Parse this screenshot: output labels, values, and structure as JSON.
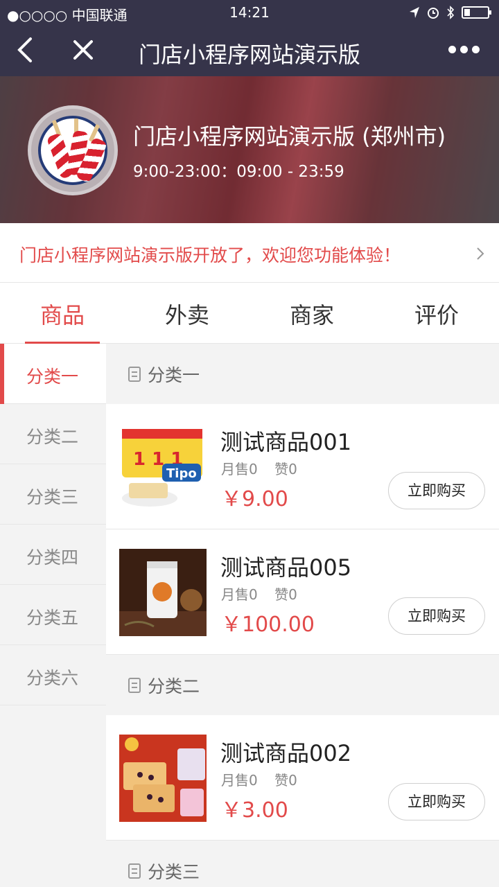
{
  "status": {
    "carrier": "●○○○○ 中国联通",
    "time": "14:21"
  },
  "nav": {
    "title": "门店小程序网站演示版"
  },
  "store": {
    "name": "门店小程序网站演示版 (郑州市)",
    "hours": "9:00-23:00：09:00 - 23:59"
  },
  "notice": {
    "text": "门店小程序网站演示版开放了，欢迎您功能体验！"
  },
  "tabs": [
    {
      "label": "商品"
    },
    {
      "label": "外卖"
    },
    {
      "label": "商家"
    },
    {
      "label": "评价"
    }
  ],
  "categories": [
    {
      "label": "分类一"
    },
    {
      "label": "分类二"
    },
    {
      "label": "分类三"
    },
    {
      "label": "分类四"
    },
    {
      "label": "分类五"
    },
    {
      "label": "分类六"
    }
  ],
  "sections": [
    {
      "title": "分类一",
      "products": [
        {
          "name": "测试商品001",
          "sales": "月售0",
          "likes": "赞0",
          "price": "￥9.00",
          "button": "立即购买"
        },
        {
          "name": "测试商品005",
          "sales": "月售0",
          "likes": "赞0",
          "price": "￥100.00",
          "button": "立即购买"
        }
      ]
    },
    {
      "title": "分类二",
      "products": [
        {
          "name": "测试商品002",
          "sales": "月售0",
          "likes": "赞0",
          "price": "￥3.00",
          "button": "立即购买"
        }
      ]
    },
    {
      "title": "分类三",
      "products": []
    }
  ],
  "colors": {
    "nav_bg": "#36344a",
    "accent": "#e24a4a"
  }
}
